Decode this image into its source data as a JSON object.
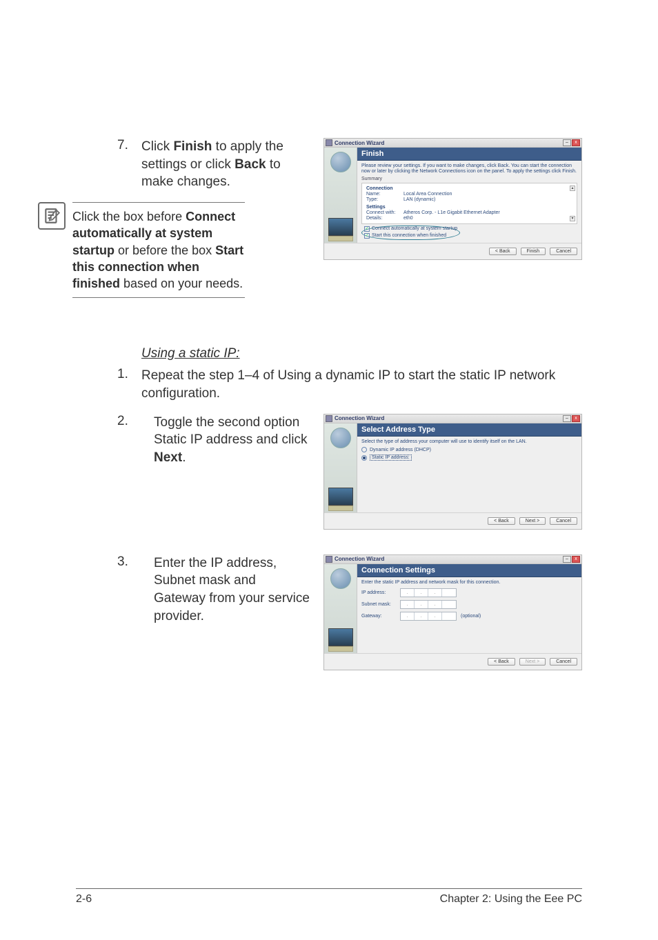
{
  "step7": {
    "num": "7.",
    "text_a": "Click ",
    "bold_a": "Finish",
    "text_b": " to apply the settings or click ",
    "bold_b": "Back",
    "text_c": " to make changes."
  },
  "note": {
    "a": "Click the box before ",
    "b1": "Connect automatically at system startup",
    "mid": " or before the box ",
    "b2": "Start this connection when finished",
    "end": " based on your needs."
  },
  "subheading": "Using a static IP:",
  "step_s1": {
    "num": "1.",
    "text": "Repeat the step 1–4 of Using a dynamic IP to start the static IP network configuration."
  },
  "step_s2": {
    "num": "2.",
    "text_a": "Toggle the second option Static IP address and click ",
    "bold": "Next",
    "text_b": "."
  },
  "step_s3": {
    "num": "3.",
    "text": "Enter the IP address, Subnet mask and Gateway from your service provider."
  },
  "wizard_title": "Connection Wizard",
  "win_min": "–",
  "win_close": "x",
  "shot1": {
    "banner": "Finish",
    "instr": "Please review your settings. If you want to make changes, click Back. You can start the connection now or later by clicking the Network Connections icon on the panel. To apply the settings click Finish.",
    "summary": "Summary",
    "conn_hdr": "Connection",
    "name_k": "Name:",
    "name_v": "Local Area Connection",
    "type_k": "Type:",
    "type_v": "LAN (dynamic)",
    "set_hdr": "Settings",
    "cw_k": "Connect with:",
    "cw_v": "Atheros Corp. - L1e Gigabit Ethernet Adapter",
    "det_k": "Details:",
    "det_v": "eth0",
    "chk1": "Connect automatically at system startup",
    "chk2": "Start this connection when finished",
    "scroll_up": "▴",
    "scroll_dn": "▾",
    "back": "< Back",
    "finish": "Finish",
    "cancel": "Cancel"
  },
  "shot2": {
    "banner": "Select Address Type",
    "instr": "Select the type of address your computer will use to identify itself on the LAN.",
    "opt1": "Dynamic IP address (DHCP)",
    "opt2": "Static IP address:",
    "back": "< Back",
    "next": "Next >",
    "cancel": "Cancel"
  },
  "shot3": {
    "banner": "Connection Settings",
    "instr": "Enter the static IP address and network mask for this connection.",
    "ip": "IP address:",
    "subnet": "Subnet mask:",
    "gateway": "Gateway:",
    "optional": "(optional)",
    "dot": ".",
    "back": "< Back",
    "next": "Next >",
    "cancel": "Cancel"
  },
  "footer": {
    "left": "2-6",
    "right": "Chapter 2: Using the Eee PC"
  }
}
